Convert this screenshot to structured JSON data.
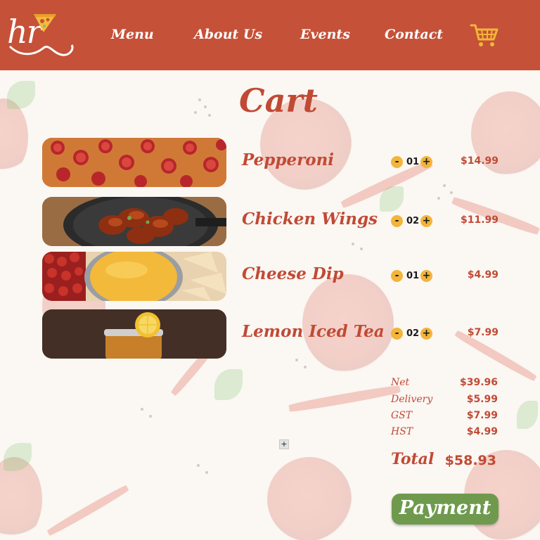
{
  "header": {
    "logo_text": "hr",
    "nav": [
      "Menu",
      "About Us",
      "Events",
      "Contact"
    ],
    "cart_icon": "shopping-cart-icon"
  },
  "page": {
    "title": "Cart"
  },
  "items": [
    {
      "name": "Pepperoni",
      "qty": "01",
      "price": "$14.99",
      "image": "pepperoni-pizza"
    },
    {
      "name": "Chicken Wings",
      "qty": "02",
      "price": "$11.99",
      "image": "chicken-wings"
    },
    {
      "name": "Cheese Dip",
      "qty": "01",
      "price": "$4.99",
      "image": "cheese-dip"
    },
    {
      "name": "Lemon Iced Tea",
      "qty": "02",
      "price": "$7.99",
      "image": "lemon-iced-tea"
    }
  ],
  "qty_controls": {
    "minus": "-",
    "plus": "+"
  },
  "summary": [
    {
      "label": "Net",
      "value": "$39.96"
    },
    {
      "label": "Delivery",
      "value": "$5.99"
    },
    {
      "label": "GST",
      "value": "$7.99"
    },
    {
      "label": "HST",
      "value": "$4.99"
    }
  ],
  "total": {
    "label": "Total",
    "value": "$58.93"
  },
  "small_button": "+",
  "payment_button": "Payment",
  "colors": {
    "header": "#c55138",
    "accent": "#c14a35",
    "qty_button": "#f2b53a",
    "payment": "#6f9a4e"
  }
}
